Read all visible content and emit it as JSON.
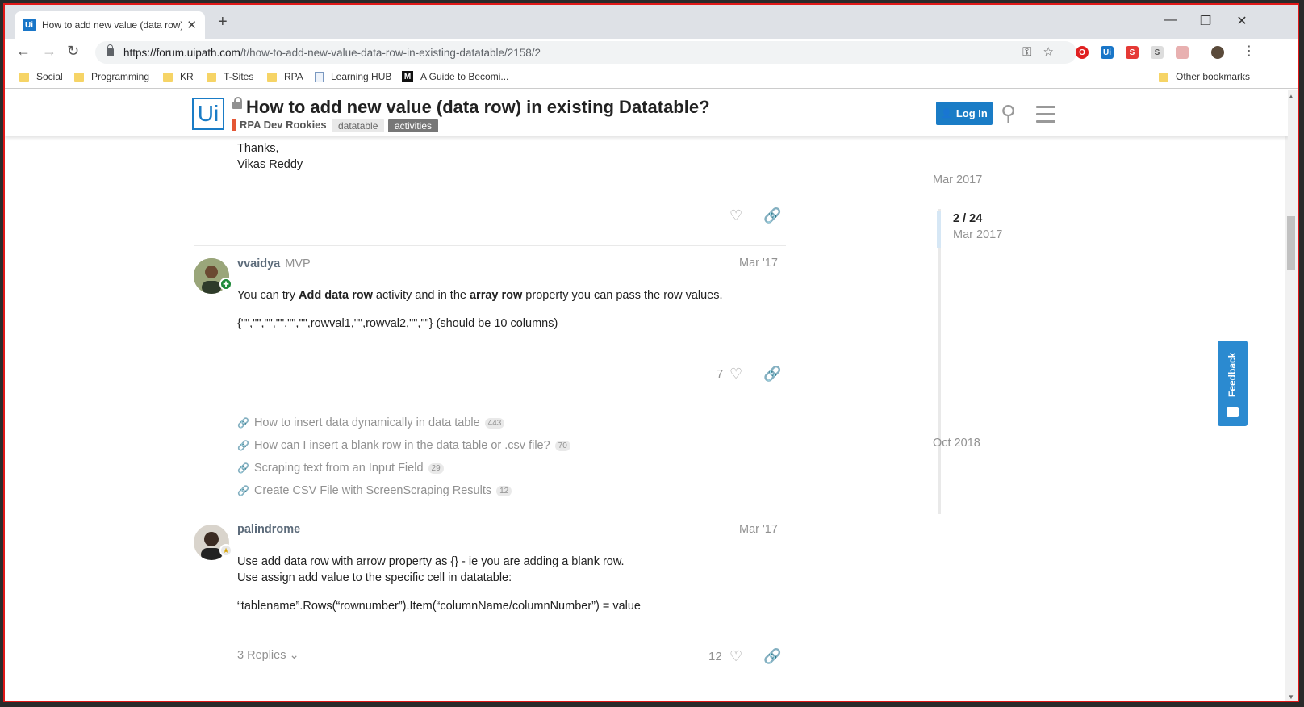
{
  "browser": {
    "tab_title": "How to add new value (data row) in existing Datatable? - Help",
    "tab_favicon": "Ui",
    "url_host": "https://forum.uipath.com",
    "url_path": "/t/how-to-add-new-value-data-row-in-existing-datatable/2158/2",
    "bookmarks": [
      "Social",
      "Programming",
      "KR",
      "T-Sites",
      "RPA",
      "Learning HUB",
      "A Guide to Becomi..."
    ],
    "other_bookmarks": "Other bookmarks",
    "ext_ui": "Ui",
    "ext_s": "S",
    "ext_s2": "S"
  },
  "header": {
    "logo": "Ui",
    "title": "How to add new value (data row) in existing Datatable?",
    "category": "RPA Dev Rookies",
    "tags": [
      "datatable",
      "activities"
    ],
    "login_label": "Log In"
  },
  "prev_post": {
    "line1": "Thanks,",
    "line2": "Vikas Reddy"
  },
  "post2": {
    "author": "vvaidya",
    "flair": "MVP",
    "date": "Mar '17",
    "text_1": "You can try ",
    "bold_1": "Add data row",
    "text_2": " activity and in the ",
    "bold_2": "array row",
    "text_3": " property you can pass the row values.",
    "code": "{\"\",\"\",\"\",\"\",\"\",\"\",rowval1,\"\",rowval2,\"\",\"\"} (should be 10 columns)",
    "likes": "7",
    "links": [
      {
        "title": "How to insert data dynamically in data table",
        "clicks": "443"
      },
      {
        "title": "How can I insert a blank row in the data table or .csv file?",
        "clicks": "70"
      },
      {
        "title": "Scraping text from an Input Field",
        "clicks": "29"
      },
      {
        "title": "Create CSV File with ScreenScraping Results",
        "clicks": "12"
      }
    ]
  },
  "post3": {
    "author": "palindrome",
    "date": "Mar '17",
    "line1": "Use add data row with arrow property as {} - ie you are adding a blank row.",
    "line2": "Use assign add value to the specific cell in datatable:",
    "code": "“tablename”.Rows(“rownumber”).Item(“columnName/columnNumber”) = value",
    "replies": "3 Replies",
    "likes": "12"
  },
  "timeline": {
    "top_date": "Mar 2017",
    "position": "2 / 24",
    "position_date": "Mar 2017",
    "bottom_date": "Oct 2018"
  },
  "feedback_label": "Feedback",
  "colors": {
    "accent": "#1a7cc6",
    "category": "#e45735",
    "frame_border": "#e01818"
  }
}
